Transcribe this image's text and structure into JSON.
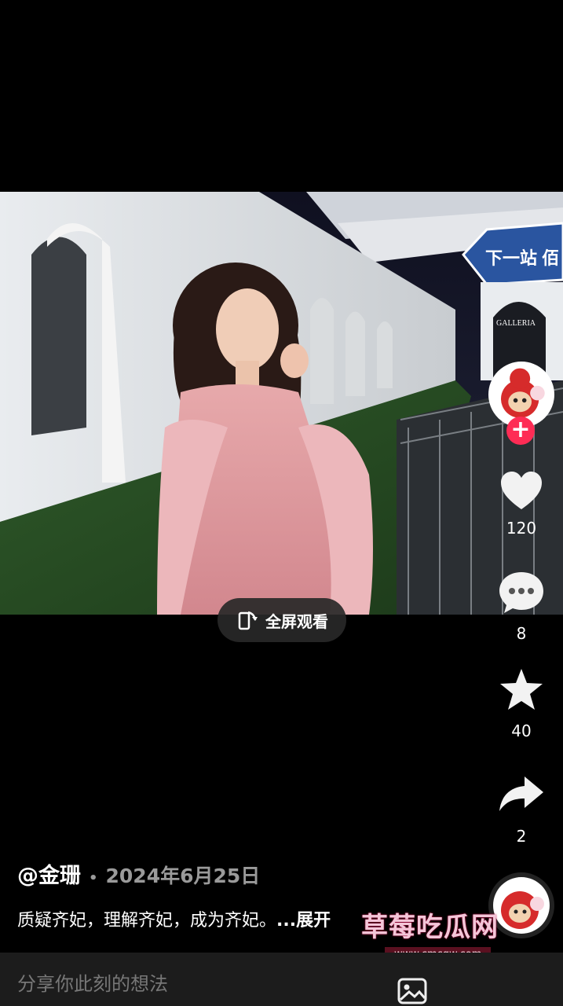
{
  "video": {
    "fullscreen_label": "全屏观看",
    "sign_text": "下一站 佰",
    "gate_text": "GALLERIA"
  },
  "rail": {
    "like_count": "120",
    "comment_count": "8",
    "favorite_count": "40",
    "share_count": "2"
  },
  "post": {
    "author": "@金珊",
    "date": "2024年6月25日",
    "caption": "质疑齐妃，理解齐妃，成为齐妃。",
    "more": "...展开"
  },
  "watermark": {
    "title": "草莓吃瓜网",
    "url": "www.cmcgw.com"
  },
  "comment": {
    "placeholder": "分享你此刻的想法"
  },
  "colors": {
    "accent": "#fe2c55",
    "background": "#000000"
  }
}
